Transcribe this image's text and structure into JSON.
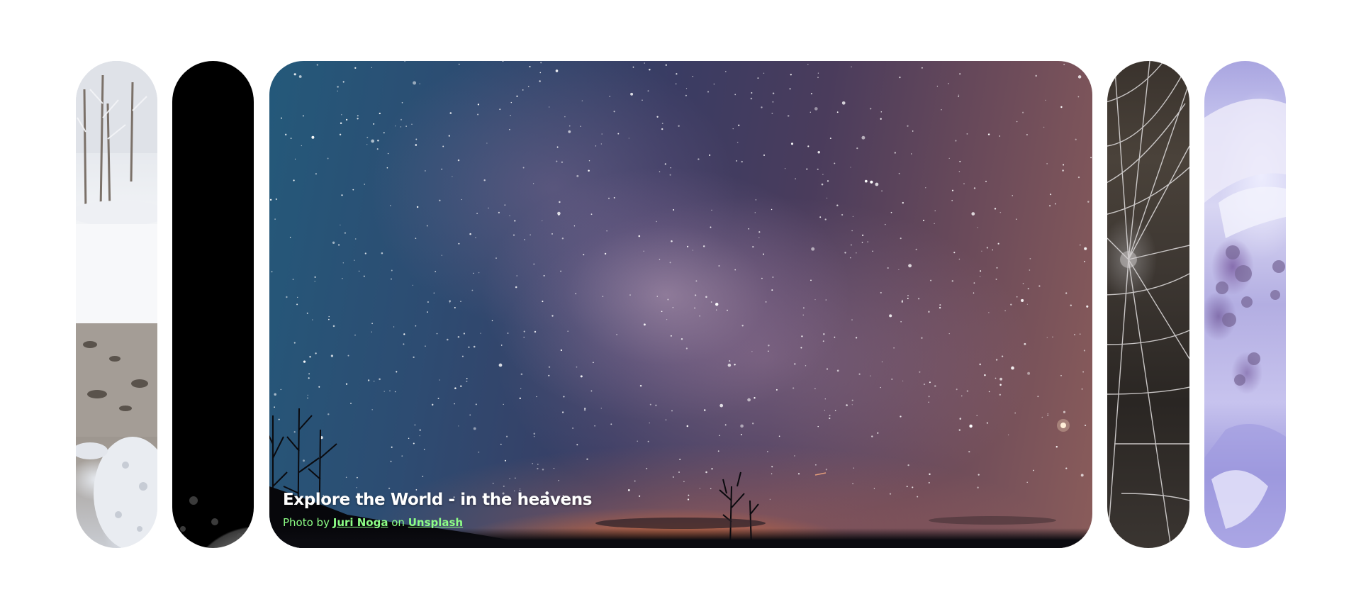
{
  "panels": [
    {
      "id": "p1",
      "name": "snowy-forest-panel",
      "state": "collapsed"
    },
    {
      "id": "p2",
      "name": "moon-panel",
      "state": "collapsed"
    },
    {
      "id": "p3",
      "name": "milky-way-panel",
      "state": "expanded",
      "title": "Explore the World - in the heavens",
      "credit_prefix": "Photo by ",
      "author": "Juri Noga",
      "credit_middle": " on ",
      "source": "Unsplash"
    },
    {
      "id": "p4",
      "name": "spider-web-panel",
      "state": "collapsed"
    },
    {
      "id": "p5",
      "name": "purple-snow-panel",
      "state": "collapsed"
    }
  ],
  "colors": {
    "credit_link": "#8dff86",
    "caption_text": "#ffffff",
    "background": "#ffffff"
  }
}
